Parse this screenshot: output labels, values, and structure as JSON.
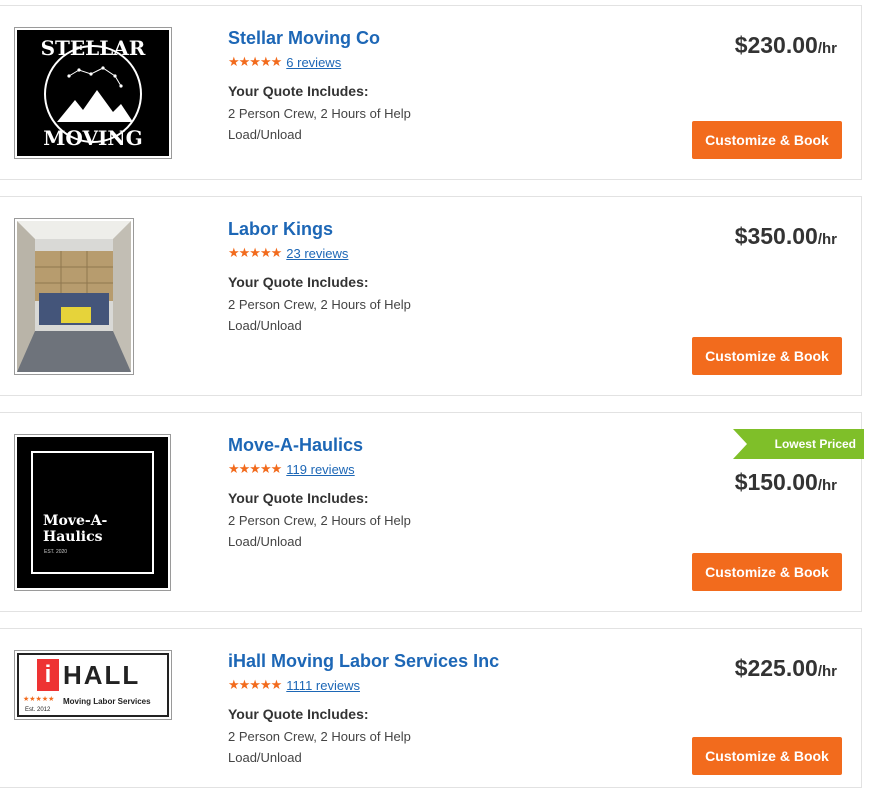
{
  "listings": [
    {
      "name": "Stellar Moving Co",
      "stars": "★★★★★",
      "reviews": "6 reviews",
      "quote_label": "Your Quote Includes:",
      "quote_line1": "2 Person Crew, 2 Hours of Help",
      "quote_line2": "Load/Unload",
      "price": "$230.00",
      "unit": "/hr",
      "button": "Customize & Book",
      "logo_text_top": "STELLAR",
      "logo_text_bottom": "MOVING"
    },
    {
      "name": "Labor Kings",
      "stars": "★★★★★",
      "reviews": "23 reviews",
      "quote_label": "Your Quote Includes:",
      "quote_line1": "2 Person Crew, 2 Hours of Help",
      "quote_line2": "Load/Unload",
      "price": "$350.00",
      "unit": "/hr",
      "button": "Customize & Book"
    },
    {
      "name": "Move-A-Haulics",
      "stars": "★★★★★",
      "reviews": "119 reviews",
      "quote_label": "Your Quote Includes:",
      "quote_line1": "2 Person Crew, 2 Hours of Help",
      "quote_line2": "Load/Unload",
      "price": "$150.00",
      "unit": "/hr",
      "button": "Customize & Book",
      "badge": "Lowest Priced",
      "logo_text_line1": "Move-A-",
      "logo_text_line2": "Haulics",
      "logo_est": "EST. 2020"
    },
    {
      "name": "iHall Moving Labor Services Inc",
      "stars": "★★★★★",
      "reviews": "1111 reviews",
      "quote_label": "Your Quote Includes:",
      "quote_line1": "2 Person Crew, 2 Hours of Help",
      "quote_line2": "Load/Unload",
      "price": "$225.00",
      "unit": "/hr",
      "button": "Customize & Book",
      "logo_text_i": "i",
      "logo_text_hall": "HALL",
      "logo_tagline": "Moving Labor Services",
      "logo_est": "Est. 2012"
    }
  ],
  "colors": {
    "accent_orange": "#f26b1d",
    "link_blue": "#1d67b6",
    "badge_green": "#7fbf29"
  }
}
